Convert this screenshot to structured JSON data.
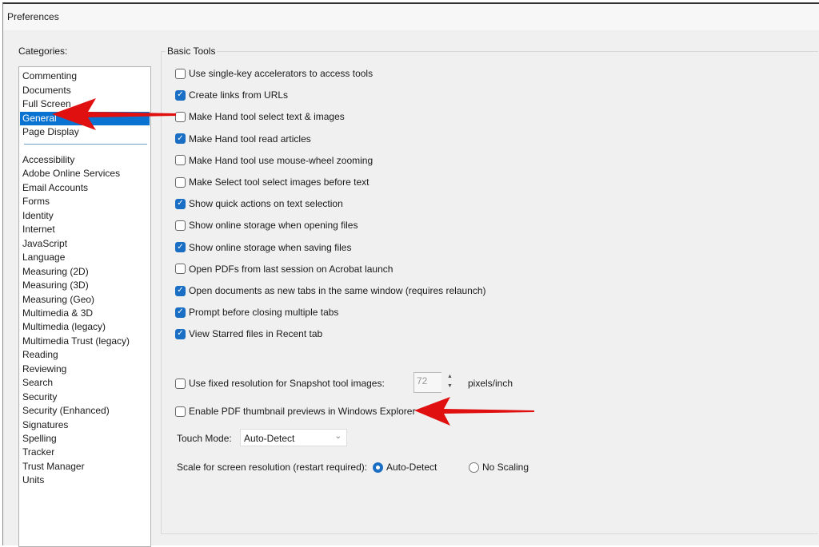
{
  "window": {
    "title": "Preferences"
  },
  "categories": {
    "label": "Categories:",
    "top": [
      "Commenting",
      "Documents",
      "Full Screen",
      "General",
      "Page Display"
    ],
    "selected": "General",
    "rest": [
      "Accessibility",
      "Adobe Online Services",
      "Email Accounts",
      "Forms",
      "Identity",
      "Internet",
      "JavaScript",
      "Language",
      "Measuring (2D)",
      "Measuring (3D)",
      "Measuring (Geo)",
      "Multimedia & 3D",
      "Multimedia (legacy)",
      "Multimedia Trust (legacy)",
      "Reading",
      "Reviewing",
      "Search",
      "Security",
      "Security (Enhanced)",
      "Signatures",
      "Spelling",
      "Tracker",
      "Trust Manager",
      "Units"
    ]
  },
  "basic_tools": {
    "title": "Basic Tools",
    "options": [
      {
        "label": "Use single-key accelerators to access tools",
        "checked": false
      },
      {
        "label": "Create links from URLs",
        "checked": true
      },
      {
        "label": "Make Hand tool select text & images",
        "checked": false
      },
      {
        "label": "Make Hand tool read articles",
        "checked": true
      },
      {
        "label": "Make Hand tool use mouse-wheel zooming",
        "checked": false
      },
      {
        "label": "Make Select tool select images before text",
        "checked": false
      },
      {
        "label": "Show quick actions on text selection",
        "checked": true
      },
      {
        "label": "Show online storage when opening files",
        "checked": false
      },
      {
        "label": "Show online storage when saving files",
        "checked": true
      },
      {
        "label": "Open PDFs from last session on Acrobat launch",
        "checked": false
      },
      {
        "label": "Open documents as new tabs in the same window (requires relaunch)",
        "checked": true
      },
      {
        "label": "Prompt before closing multiple tabs",
        "checked": true
      },
      {
        "label": "View Starred files in Recent tab",
        "checked": true
      }
    ],
    "snapshot": {
      "label": "Use fixed resolution for Snapshot tool images:",
      "checked": false,
      "value": "72",
      "unit": "pixels/inch"
    },
    "thumbnail": {
      "label": "Enable PDF thumbnail previews in Windows Explorer",
      "checked": false
    },
    "touch_mode": {
      "label": "Touch Mode:",
      "value": "Auto-Detect"
    },
    "scale": {
      "label": "Scale for screen resolution (restart required):",
      "options": [
        "Auto-Detect",
        "No Scaling"
      ],
      "selected": "Auto-Detect"
    }
  },
  "annotations": {
    "arrow_color": "#e01010"
  },
  "colors": {
    "selection": "#0a72d0",
    "checkbox": "#1a6fc4"
  }
}
